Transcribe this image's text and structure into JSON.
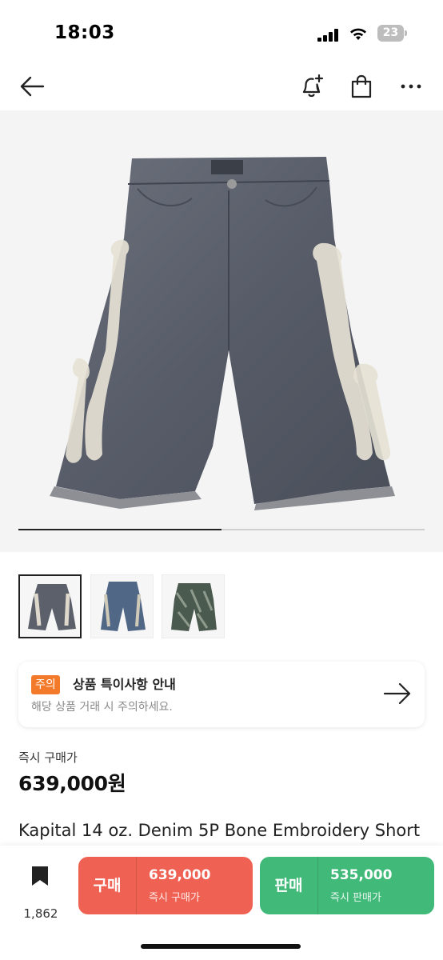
{
  "status_bar": {
    "time": "18:03",
    "battery": "23"
  },
  "nav": {
    "icons": [
      "arrow-left-icon",
      "bell-plus-icon",
      "shopping-bag-icon",
      "more-horizontal-icon"
    ]
  },
  "gallery": {
    "image_count": 3,
    "current_index": 1,
    "progress_fraction": 0.5
  },
  "notice": {
    "badge": "주의",
    "title": "상품 특이사항 안내",
    "subtitle": "해당 상품 거래 시 주의하세요."
  },
  "price": {
    "label": "즉시 구매가",
    "value": "639,000원"
  },
  "product": {
    "name": "Kapital 14 oz. Denim 5P Bone Embroidery Short"
  },
  "bottom": {
    "bookmark_count": "1,862",
    "buy": {
      "label": "구매",
      "price": "639,000",
      "sub": "즉시 구매가"
    },
    "sell": {
      "label": "판매",
      "price": "535,000",
      "sub": "즉시 판매가"
    }
  },
  "colors": {
    "buy": "#ef6253",
    "sell": "#41b979",
    "notice_badge": "#f37a2a",
    "hero_bg": "#f4f4f4"
  }
}
